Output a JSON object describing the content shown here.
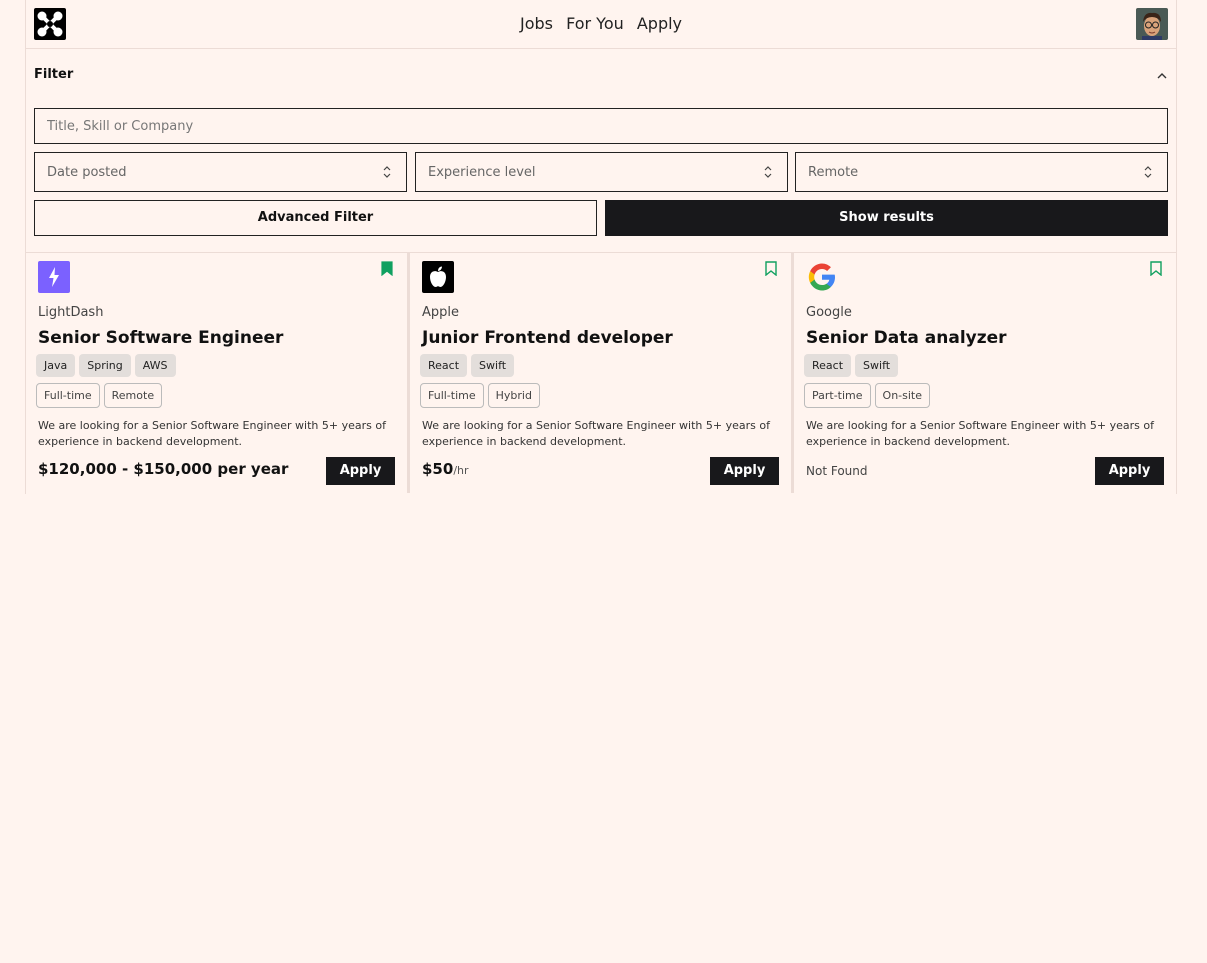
{
  "nav": {
    "items": [
      "Jobs",
      "For You",
      "Apply"
    ]
  },
  "filter": {
    "title": "Filter",
    "search_placeholder": "Title, Skill or Company",
    "selects": [
      "Date posted",
      "Experience level",
      "Remote"
    ],
    "advanced_label": "Advanced Filter",
    "show_label": "Show results"
  },
  "colors": {
    "background": "#fff4ef",
    "dark": "#18181b",
    "bookmark": "#10a060",
    "lightdash": "#7b61ff"
  },
  "jobs": [
    {
      "logo_icon": "lightning-icon",
      "company": "LightDash",
      "title": "Senior Software Engineer",
      "skills": [
        "Java",
        "Spring",
        "AWS"
      ],
      "types": [
        "Full-time",
        "Remote"
      ],
      "description": "We are looking for a Senior Software Engineer with 5+ years of experience in backend development.",
      "salary": "$120,000 - $150,000 per year",
      "salary_unit": "",
      "bookmarked": true,
      "apply_label": "Apply"
    },
    {
      "logo_icon": "apple-icon",
      "company": "Apple",
      "title": "Junior Frontend developer",
      "skills": [
        "React",
        "Swift"
      ],
      "types": [
        "Full-time",
        "Hybrid"
      ],
      "description": "We are looking for a Senior Software Engineer with 5+ years of experience in backend development.",
      "salary": "$50",
      "salary_unit": "/hr",
      "bookmarked": false,
      "apply_label": "Apply"
    },
    {
      "logo_icon": "google-icon",
      "company": "Google",
      "title": "Senior Data analyzer",
      "skills": [
        "React",
        "Swift"
      ],
      "types": [
        "Part-time",
        "On-site"
      ],
      "description": "We are looking for a Senior Software Engineer with 5+ years of experience in backend development.",
      "salary": "Not Found",
      "salary_unit": "",
      "bookmarked": false,
      "apply_label": "Apply"
    }
  ]
}
